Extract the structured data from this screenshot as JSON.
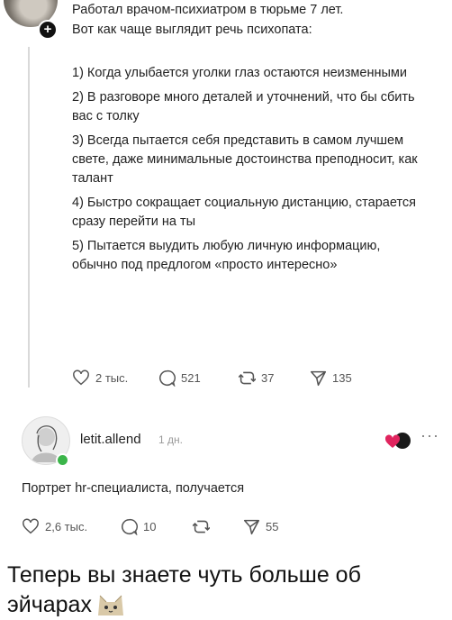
{
  "post": {
    "intro_line1": "Работал врачом-психиатром в тюрьме 7 лет.",
    "intro_line2": "Вот как чаще выглядит речь психопата:",
    "points": [
      "1) Когда улыбается уголки глаз остаются неизменными",
      "2) В разговоре много деталей и уточнений, что бы сбить вас с толку",
      "3) Всегда пытается себя представить в самом лучшем свете, даже минимальные достоинства преподносит, как талант",
      "4) Быстро сокращает социальную дистанцию, старается сразу перейти на ты",
      "5) Пытается выудить любую личную информацию, обычно под предлогом «просто интересно»"
    ],
    "likes": "2 тыс.",
    "comments": "521",
    "reposts": "37",
    "shares": "135"
  },
  "reply": {
    "username": "letit.allend",
    "time": "1 дн.",
    "text": "Портрет hr-специалиста, получается",
    "likes": "2,6 тыс.",
    "comments": "10",
    "reposts": "",
    "shares": "55"
  },
  "caption": "Теперь вы знаете чуть больше об эйчарах",
  "icons": [
    "plus-icon",
    "heart-icon",
    "comment-icon",
    "repost-icon",
    "send-icon",
    "more-icon",
    "heart-emoji-icon",
    "cat-emoji-icon"
  ]
}
